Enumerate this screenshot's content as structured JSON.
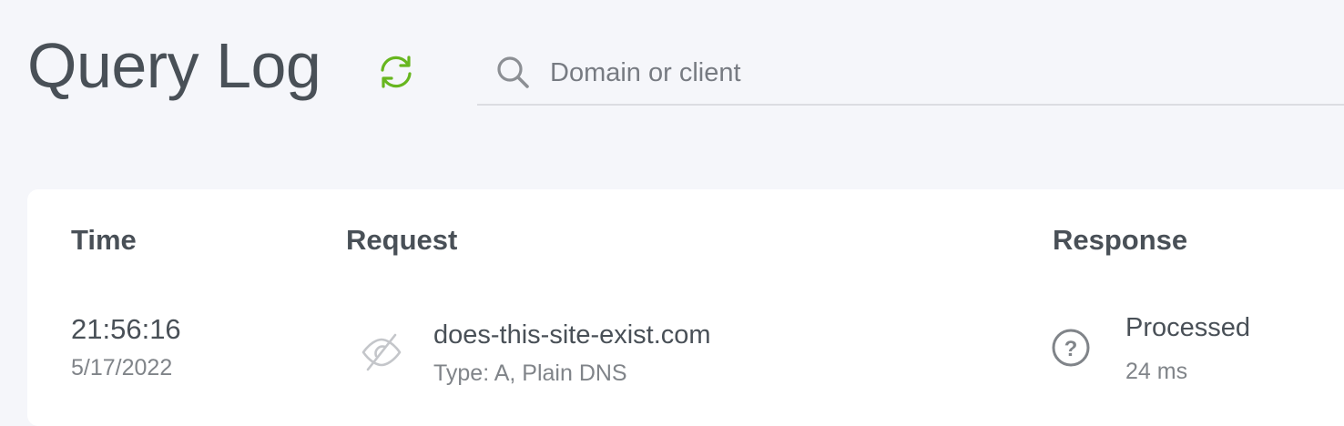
{
  "header": {
    "title": "Query Log",
    "refresh_icon": "refresh-icon",
    "accent_color": "#67b61f"
  },
  "search": {
    "placeholder": "Domain or client",
    "value": "",
    "icon": "search-icon"
  },
  "table": {
    "columns": [
      "Time",
      "Request",
      "Response"
    ],
    "rows": [
      {
        "time": "21:56:16",
        "date": "5/17/2022",
        "request_icon": "eye-slash-icon",
        "domain": "does-this-site-exist.com",
        "type": "Type: A, Plain DNS",
        "response_icon": "question-circle-icon",
        "status": "Processed",
        "elapsed": "24 ms"
      }
    ]
  }
}
